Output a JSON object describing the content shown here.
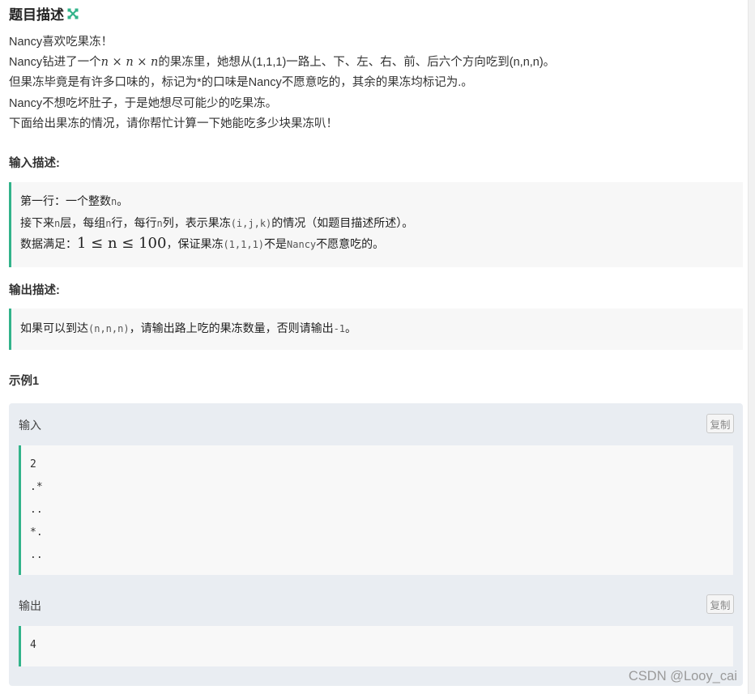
{
  "title": "题目描述",
  "description": {
    "line1": "Nancy喜欢吃果冻！",
    "line2_a": "Nancy钻进了一个",
    "line2_math": "n × n × n",
    "line2_b": "的果冻里，她想从(1,1,1)一路上、下、左、右、前、后六个方向吃到(n,n,n)。",
    "line3": "但果冻毕竟是有许多口味的，标记为*的口味是Nancy不愿意吃的，其余的果冻均标记为.。",
    "line4": "Nancy不想吃坏肚子，于是她想尽可能少的吃果冻。",
    "line5": "下面给出果冻的情况，请你帮忙计算一下她能吃多少块果冻叭！"
  },
  "input_desc": {
    "heading": "输入描述:",
    "l1_a": "第一行：一个整数",
    "l1_code": "n",
    "l1_b": "。",
    "l2_a": "接下来",
    "l2_c1": "n",
    "l2_b": "层，每组",
    "l2_c2": "n",
    "l2_c": "行，每行",
    "l2_c3": "n",
    "l2_d": "列，表示果冻",
    "l2_c4": "(i,j,k)",
    "l2_e": "的情况（如题目描述所述）。",
    "l3_a": "数据满足：",
    "l3_math": "1 ≤ n ≤ 100",
    "l3_b": "，保证果冻",
    "l3_c1": "(1,1,1)",
    "l3_c": "不是",
    "l3_c2": "Nancy",
    "l3_d": "不愿意吃的。"
  },
  "output_desc": {
    "heading": "输出描述:",
    "l1_a": "如果可以到达",
    "l1_c1": "(n,n,n)",
    "l1_b": "，请输出路上吃的果冻数量，否则请输出",
    "l1_c2": "-1",
    "l1_c": "。"
  },
  "example": {
    "heading": "示例1",
    "input_label": "输入",
    "output_label": "输出",
    "copy_label": "复制",
    "input_lines": [
      "2",
      ".*",
      "..",
      "*.",
      ".."
    ],
    "output_lines": [
      "4"
    ]
  },
  "watermark": "CSDN @Looy_cai",
  "colors": {
    "accent": "#32b38a",
    "example_bg": "#e9edf2"
  }
}
